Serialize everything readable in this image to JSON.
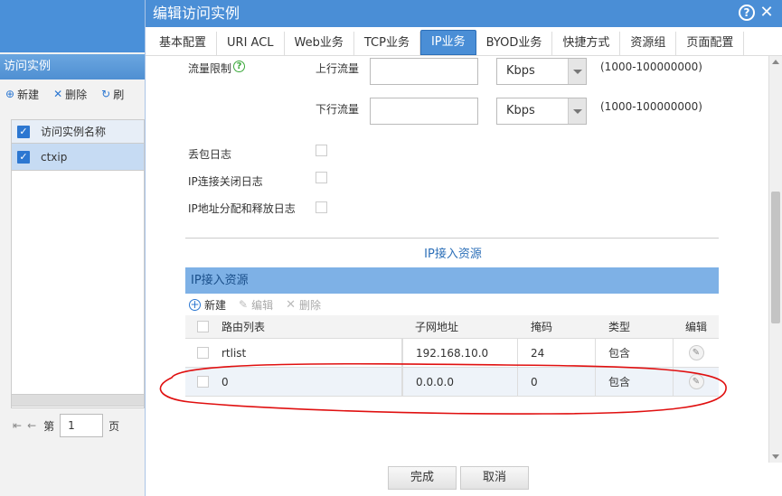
{
  "background": {
    "panel_title": "访问实例",
    "toolbar": {
      "new_label": "新建",
      "delete_label": "删除",
      "refresh_label": "刷"
    },
    "grid": {
      "header": "访问实例名称",
      "rows": [
        "ctxip"
      ]
    },
    "pager": {
      "page_label": "第",
      "page_value": "1",
      "page_suffix": "页"
    }
  },
  "dialog": {
    "title": "编辑访问实例",
    "tabs": [
      {
        "label": "基本配置"
      },
      {
        "label": "URI ACL"
      },
      {
        "label": "Web业务"
      },
      {
        "label": "TCP业务"
      },
      {
        "label": "IP业务"
      },
      {
        "label": "BYOD业务"
      },
      {
        "label": "快捷方式"
      },
      {
        "label": "资源组"
      },
      {
        "label": "页面配置"
      }
    ],
    "active_tab": "IP业务",
    "form": {
      "rate_limit_label": "流量限制",
      "upstream_label": "上行流量",
      "downstream_label": "下行流量",
      "upstream_unit": "Kbps",
      "downstream_unit": "Kbps",
      "upstream_range": "(1000-100000000)",
      "downstream_range": "(1000-100000000)",
      "drop_log_label": "丢包日志",
      "ip_close_log_label": "IP连接关闭日志",
      "ip_alloc_log_label": "IP地址分配和释放日志"
    },
    "section_title": "IP接入资源",
    "grid": {
      "title": "IP接入资源",
      "toolbar": {
        "new_label": "新建",
        "edit_label": "编辑",
        "delete_label": "删除"
      },
      "columns": [
        "路由列表",
        "子网地址",
        "掩码",
        "类型",
        "编辑"
      ],
      "rows": [
        {
          "route": "rtlist",
          "subnet": "192.168.10.0",
          "mask": "24",
          "type": "包含"
        },
        {
          "route": "0",
          "subnet": "0.0.0.0",
          "mask": "0",
          "type": "包含"
        }
      ]
    },
    "footer": {
      "ok_label": "完成",
      "cancel_label": "取消"
    }
  },
  "colors": {
    "accent": "#4a8ed6",
    "annotation": "#e01010"
  }
}
